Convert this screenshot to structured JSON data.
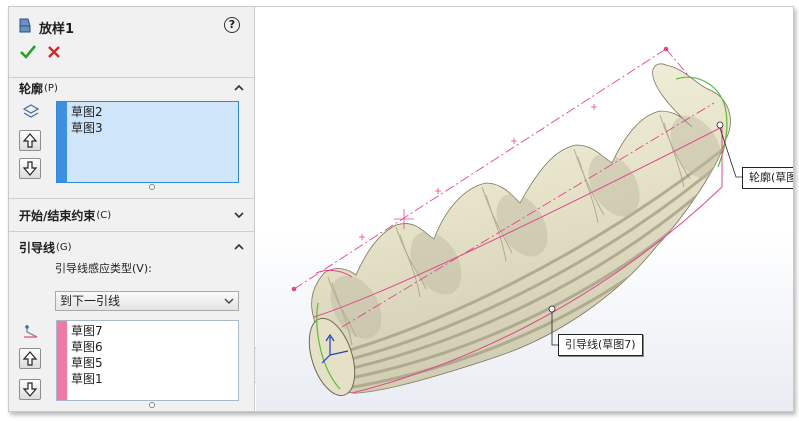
{
  "feature": {
    "title": "放样1",
    "help_label": "?"
  },
  "profiles": {
    "heading": "轮廓",
    "shortcut": "(P)",
    "items": [
      "草图2",
      "草图3"
    ]
  },
  "constraints": {
    "heading": "开始/结束约束",
    "shortcut": "(C)"
  },
  "guides": {
    "heading": "引导线",
    "shortcut": "(G)",
    "influence_label": "引导线感应类型(V):",
    "influence_value": "到下一引线",
    "items": [
      "草图7",
      "草图6",
      "草图5",
      "草图1"
    ]
  },
  "callouts": {
    "profile": "轮廓(草图",
    "guide": "引导线(草图7)"
  },
  "colors": {
    "profile_bar": "#3d8fe0",
    "guide_bar": "#f07aa6",
    "selected_list_bg": "#cfe5fa",
    "ok_green": "#2aa02a",
    "cancel_red": "#d12a2a",
    "model_fill": "#e9e6d0",
    "preview_pink": "#e0488c",
    "preview_green": "#5fb83c"
  },
  "icons": {
    "feature": "loft-icon",
    "profile": "profile-icon",
    "guide": "guide-curve-icon",
    "up": "move-up-icon",
    "down": "move-down-icon"
  }
}
